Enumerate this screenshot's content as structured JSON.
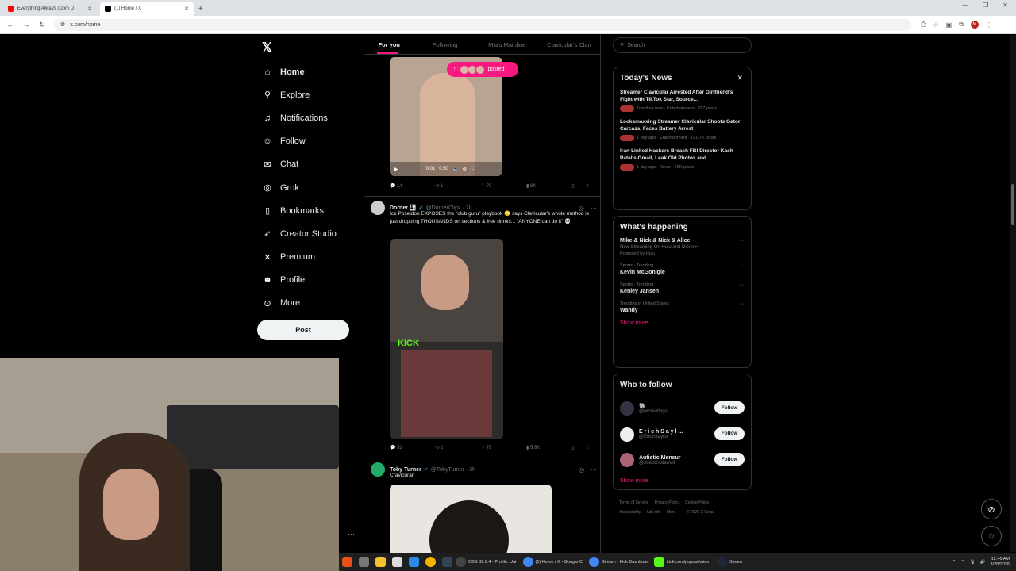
{
  "browser": {
    "tabs": [
      {
        "title": "Everything Always (Dom D",
        "favicon_color": "#ff0000",
        "active": false
      },
      {
        "title": "(1) Home / X",
        "favicon_color": "#000000",
        "active": true
      }
    ],
    "new_tab_symbol": "+",
    "url": "x.com/home",
    "profile_initial": "M"
  },
  "x_nav": {
    "logo": "𝕏",
    "items": [
      {
        "label": "Home",
        "icon": "home-icon",
        "glyph": "⌂"
      },
      {
        "label": "Explore",
        "icon": "search-icon",
        "glyph": "⚲"
      },
      {
        "label": "Notifications",
        "icon": "bell-icon",
        "glyph": "♫"
      },
      {
        "label": "Follow",
        "icon": "person-plus-icon",
        "glyph": "☺"
      },
      {
        "label": "Chat",
        "icon": "mail-icon",
        "glyph": "✉"
      },
      {
        "label": "Grok",
        "icon": "grok-icon",
        "glyph": "◎"
      },
      {
        "label": "Bookmarks",
        "icon": "bookmark-icon",
        "glyph": "▯"
      },
      {
        "label": "Creator Studio",
        "icon": "rocket-icon",
        "glyph": "➶"
      },
      {
        "label": "Premium",
        "icon": "x-premium-icon",
        "glyph": "✕"
      },
      {
        "label": "Profile",
        "icon": "person-icon",
        "glyph": "☻"
      },
      {
        "label": "More",
        "icon": "more-circle-icon",
        "glyph": "⊙"
      }
    ],
    "post_label": "Post"
  },
  "feed": {
    "tabs": [
      "For you",
      "Following",
      "Mia's Mainline",
      "Clavicular's Clan"
    ],
    "posted_pill": "posted",
    "video1": {
      "time": "0:01 / 0:50"
    },
    "tweet1_actions": {
      "replies": "14",
      "reposts": "1",
      "likes": "70",
      "views": "8K"
    },
    "tweet2": {
      "name": "Dorner 👨‍👦",
      "handle": "@DornerClipz · 7h",
      "text": "Ice Poseidon EXPOSES the \"club guru\" playbook 😳 says Clavicular's whole method is just dropping THOUSANDS on sections & free drinks... \"ANYONE can do it\" 💀",
      "kick_label": "KICK",
      "replies": "32",
      "reposts": "2",
      "likes": "78",
      "views": "5.8K"
    },
    "tweet3": {
      "name": "Toby Turner",
      "handle": "@TobyTurner · 3h",
      "text": "Cravicurar"
    }
  },
  "sidebar": {
    "search_placeholder": "Search",
    "news": {
      "title": "Today's News",
      "items": [
        {
          "headline": "Streamer Clavicular Arrested After Girlfriend's Fight with TikTok Star, Source...",
          "meta": "Trending now · Entertainment · 787 posts"
        },
        {
          "headline": "Looksmaxxing Streamer Clavicular Shoots Gator Carcass, Faces Battery Arrest",
          "meta": "1 day ago · Entertainment · 191.7K posts"
        },
        {
          "headline": "Iran-Linked Hackers Breach FBI Director Kash Patel's Gmail, Leak Old Photos and ...",
          "meta": "1 day ago · News · 56K posts"
        }
      ]
    },
    "happening": {
      "title": "What's happening",
      "items": [
        {
          "context": "",
          "topic": "Mike & Nick & Nick & Alice",
          "sub": "Now Streaming On Hulu and Disney+",
          "promo": "Promoted by Hulu"
        },
        {
          "context": "Sports · Trending",
          "topic": "Kevin McGonigle",
          "sub": "",
          "promo": ""
        },
        {
          "context": "Sports · Trending",
          "topic": "Kenley Jansen",
          "sub": "",
          "promo": ""
        },
        {
          "context": "Trending in United States",
          "topic": "Wandy",
          "sub": "",
          "promo": ""
        }
      ],
      "show_more": "Show more"
    },
    "who_to_follow": {
      "title": "Who to follow",
      "items": [
        {
          "name": "🐘",
          "handle": "@recreatings"
        },
        {
          "name": "E r i c h  S a y l ...",
          "handle": "@ErichSaylor"
        },
        {
          "name": "Autistic Mensur",
          "handle": "@JoaoCristaoVII"
        }
      ],
      "follow_label": "Follow",
      "show_more": "Show more"
    },
    "footer": [
      "Terms of Service",
      "Privacy Policy",
      "Cookie Policy",
      "Accessibility",
      "Ads info",
      "More ···",
      "© 2026 X Corp."
    ]
  },
  "taskbar": {
    "apps": [
      {
        "label": "OBS 32.0.4 - Profile: Unt",
        "color": "#333333"
      },
      {
        "label": "(1) Home / X - Google C",
        "color": "#4285f4"
      },
      {
        "label": "Stream - Kick Dashboar",
        "color": "#4285f4"
      },
      {
        "label": "kick.com/popout/miam",
        "color": "#53fc18"
      },
      {
        "label": "Steam",
        "color": "#1b2838"
      }
    ],
    "time": "12:40 AM",
    "date": "3/28/2026"
  }
}
